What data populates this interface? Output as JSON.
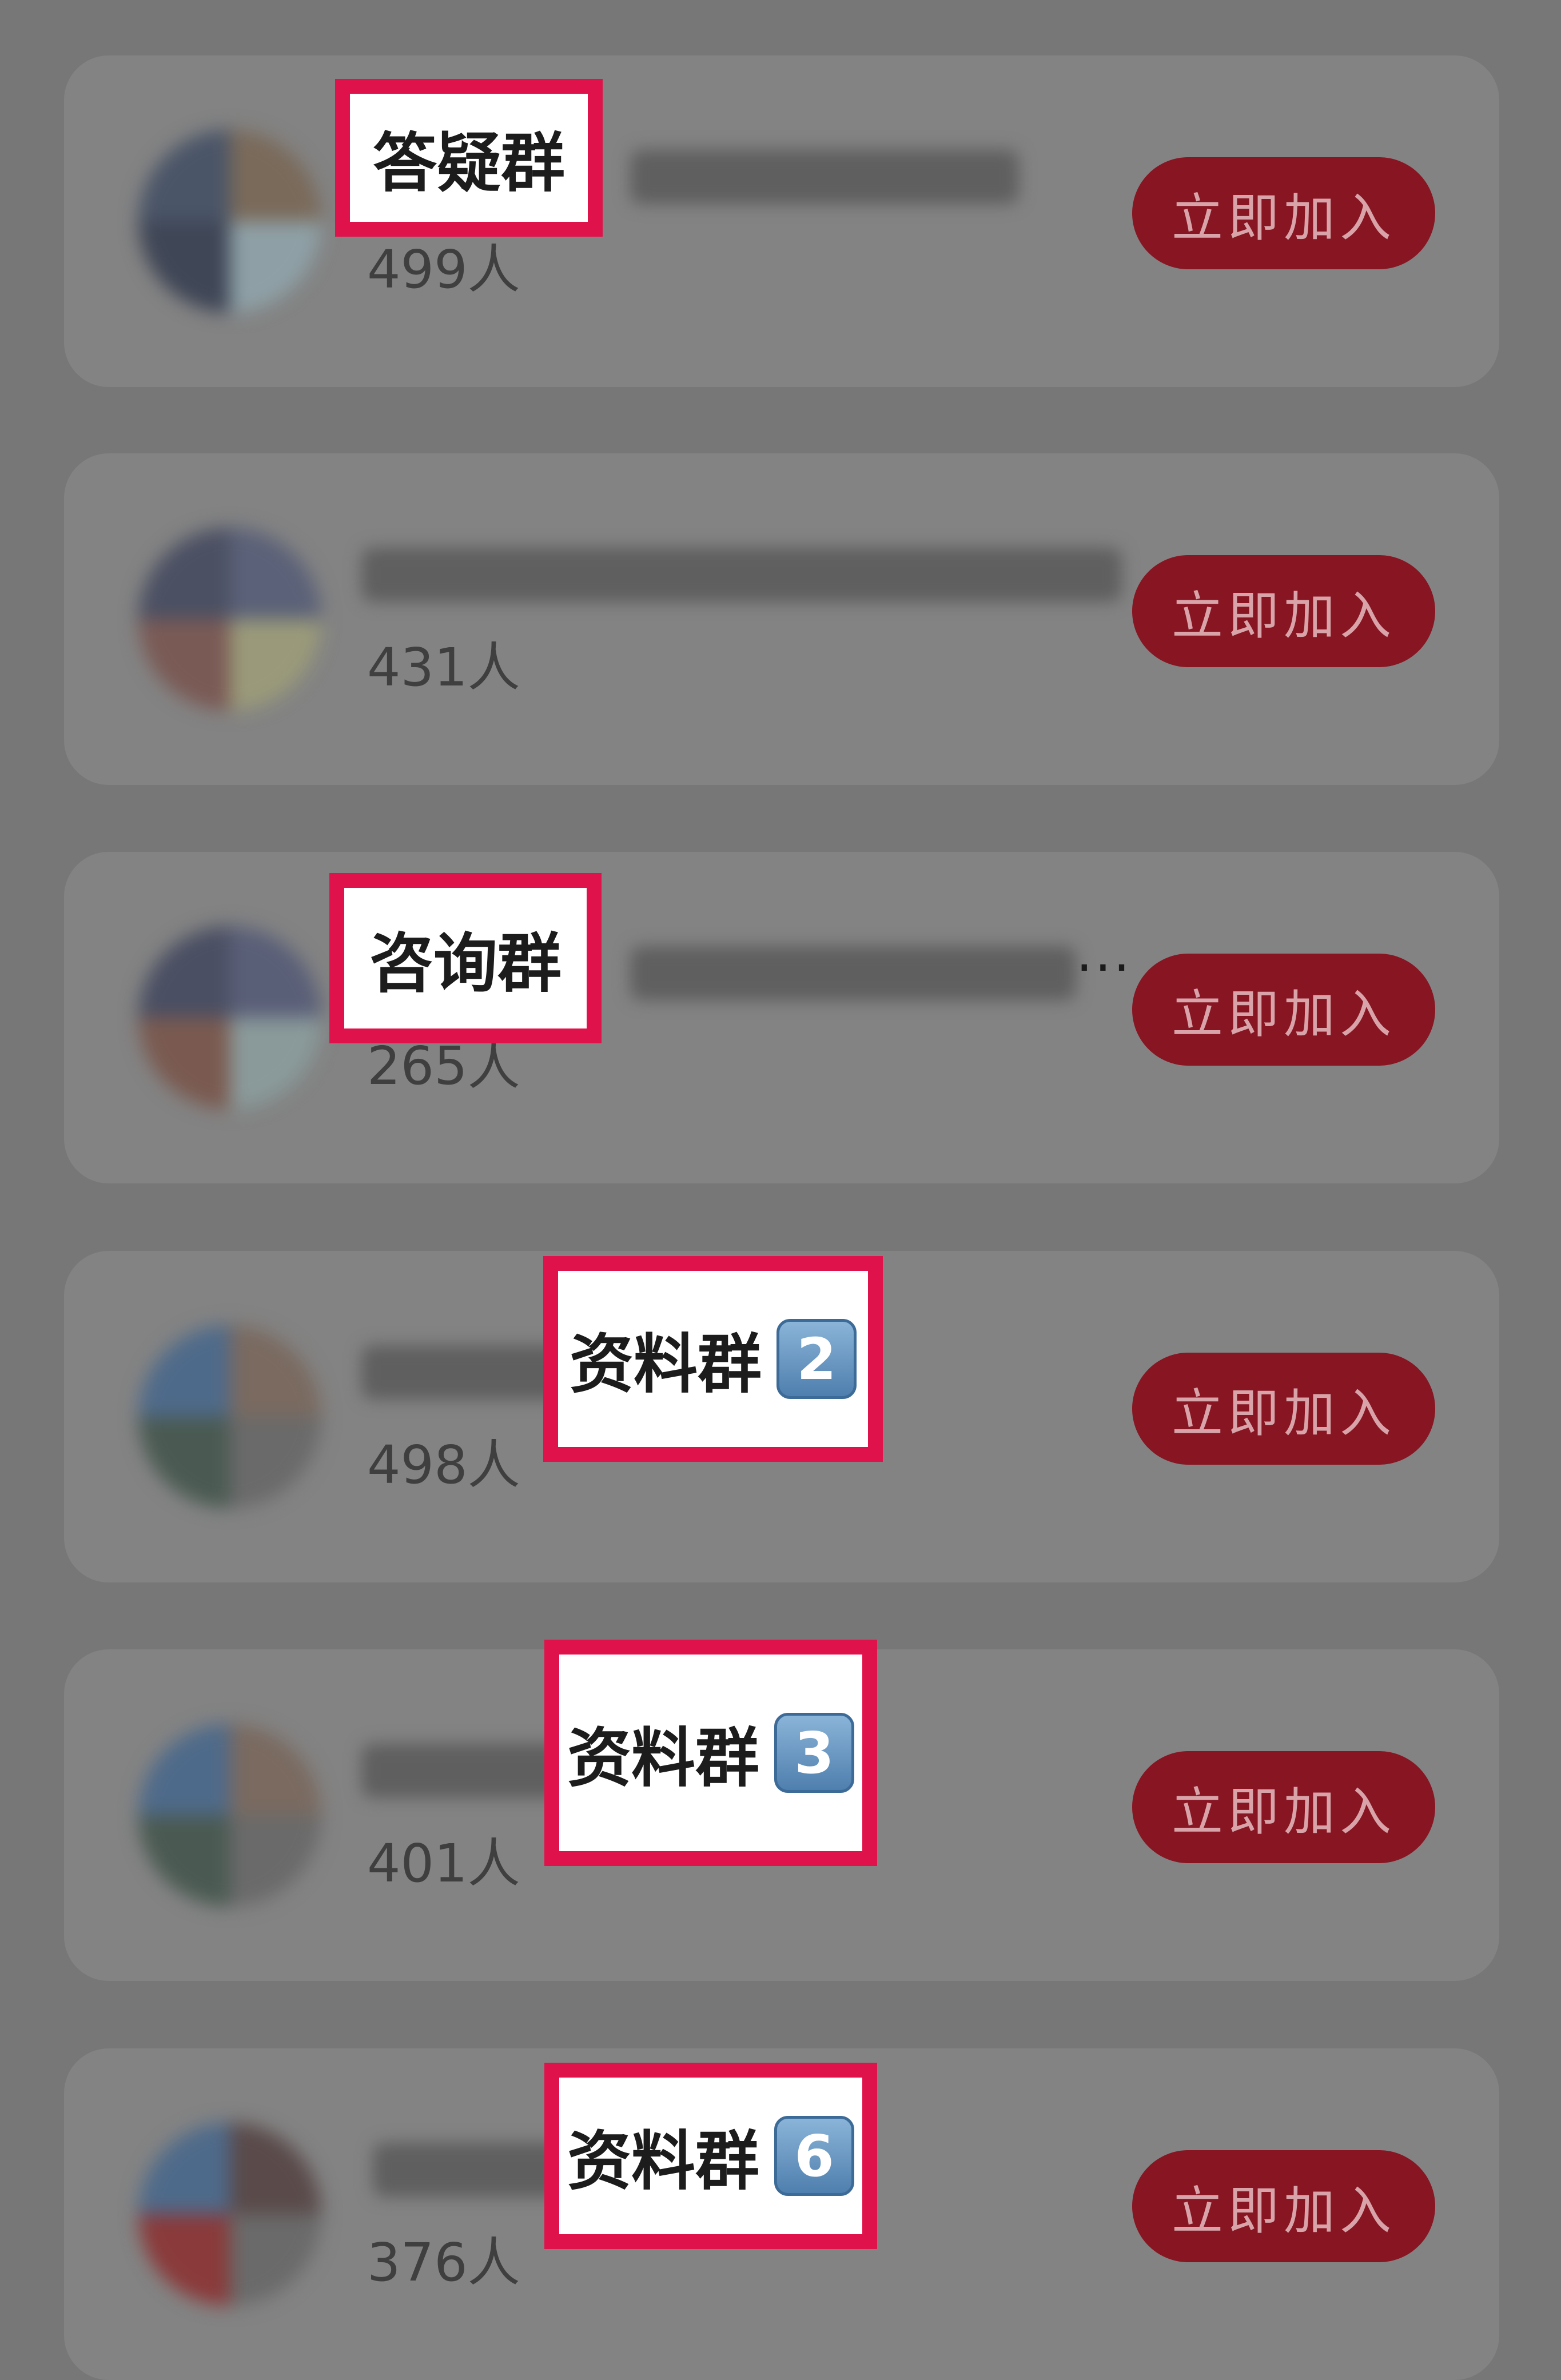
{
  "groups": [
    {
      "tag": "答疑群",
      "tag_number": "",
      "count": "499人",
      "join_label": "立即加入",
      "ellipsis": ""
    },
    {
      "tag": "",
      "tag_number": "",
      "count": "431人",
      "join_label": "立即加入",
      "ellipsis": ""
    },
    {
      "tag": "咨询群",
      "tag_number": "",
      "count": "265人",
      "join_label": "立即加入",
      "ellipsis": "..."
    },
    {
      "tag": "资料群",
      "tag_number": "2",
      "count": "498人",
      "join_label": "立即加入",
      "ellipsis": ""
    },
    {
      "tag": "资料群",
      "tag_number": "3",
      "count": "401人",
      "join_label": "立即加入",
      "ellipsis": ""
    },
    {
      "tag": "资料群",
      "tag_number": "6",
      "count": "376人",
      "join_label": "立即加入",
      "ellipsis": ""
    }
  ],
  "colors": {
    "background": "#777777",
    "card": "#838383",
    "join_button": "#871522",
    "join_text": "#d8a4a9",
    "highlight_border": "#e0124b",
    "keycap": "#5b8bbb"
  },
  "icons": [
    "group-avatar",
    "keycap-digit"
  ]
}
